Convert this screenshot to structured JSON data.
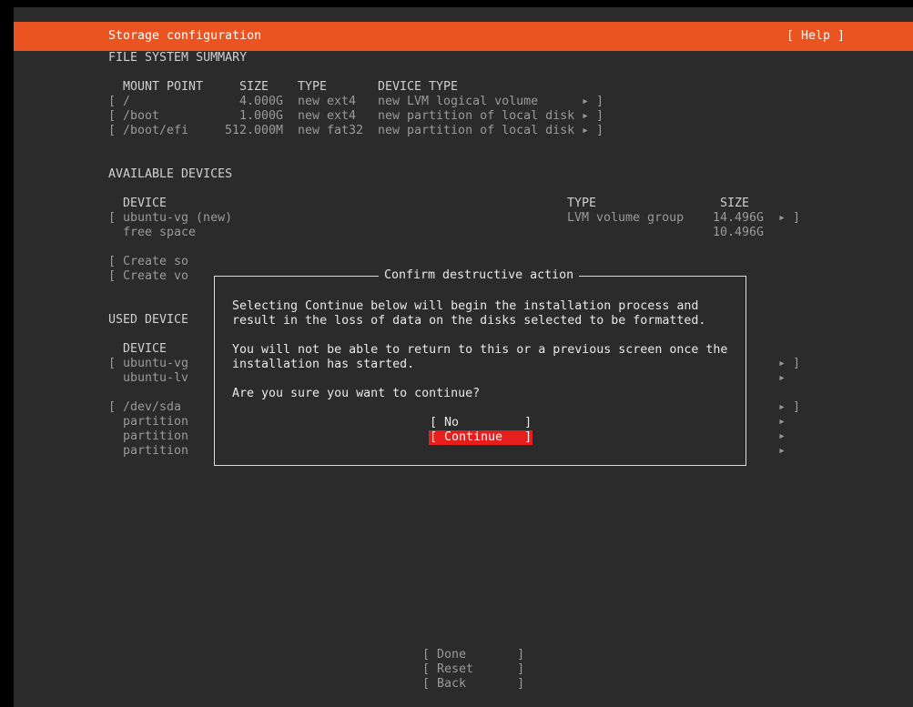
{
  "header": {
    "title": "Storage configuration",
    "help": "[ Help ]"
  },
  "fs_summary": {
    "heading": "FILE SYSTEM SUMMARY",
    "columns": [
      "MOUNT POINT",
      "SIZE",
      "TYPE",
      "DEVICE TYPE"
    ],
    "rows": [
      {
        "open": "[",
        "mount": "/",
        "size": "4.000G",
        "type": "new ext4",
        "device_type": "new LVM logical volume",
        "arrow": "▸ ]"
      },
      {
        "open": "[",
        "mount": "/boot",
        "size": "1.000G",
        "type": "new ext4",
        "device_type": "new partition of local disk",
        "arrow": "▸ ]"
      },
      {
        "open": "[",
        "mount": "/boot/efi",
        "size": "512.000M",
        "type": "new fat32",
        "device_type": "new partition of local disk",
        "arrow": "▸ ]"
      }
    ]
  },
  "available": {
    "heading": "AVAILABLE DEVICES",
    "columns": [
      "DEVICE",
      "TYPE",
      "SIZE"
    ],
    "vg": {
      "open": "[",
      "name": "ubuntu-vg (new)",
      "type": "LVM volume group",
      "size": "14.496G",
      "arrow": "▸ ]"
    },
    "free": {
      "name": "free space",
      "size": "10.496G"
    },
    "create_1": "[ Create so",
    "create_2": "[ Create vo"
  },
  "used": {
    "heading": "USED DEVICE",
    "col_device": "DEVICE",
    "rows": [
      {
        "text": "[ ubuntu-vg",
        "arrow": "▸ ]"
      },
      {
        "text": "  ubuntu-lv",
        "arrow": "▸"
      },
      {
        "text": "[ /dev/sda",
        "arrow": "▸ ]"
      },
      {
        "text": "  partition",
        "arrow": "▸"
      },
      {
        "text": "  partition",
        "arrow": "▸"
      },
      {
        "text": "  partition",
        "arrow": "▸"
      }
    ]
  },
  "dialog": {
    "title": "Confirm destructive action",
    "line1": "Selecting Continue below will begin the installation process and",
    "line2": "result in the loss of data on the disks selected to be formatted.",
    "line3": "You will not be able to return to this or a previous screen once the",
    "line4": "installation has started.",
    "line5": "Are you sure you want to continue?",
    "no": "[ No         ]",
    "continue": "[ Continue   ]"
  },
  "footer": {
    "done": "[ Done       ]",
    "reset": "[ Reset      ]",
    "back": "[ Back       ]"
  },
  "colors": {
    "accent": "#e95420",
    "focus": "#e61e1e",
    "background": "#2b2b2b"
  }
}
